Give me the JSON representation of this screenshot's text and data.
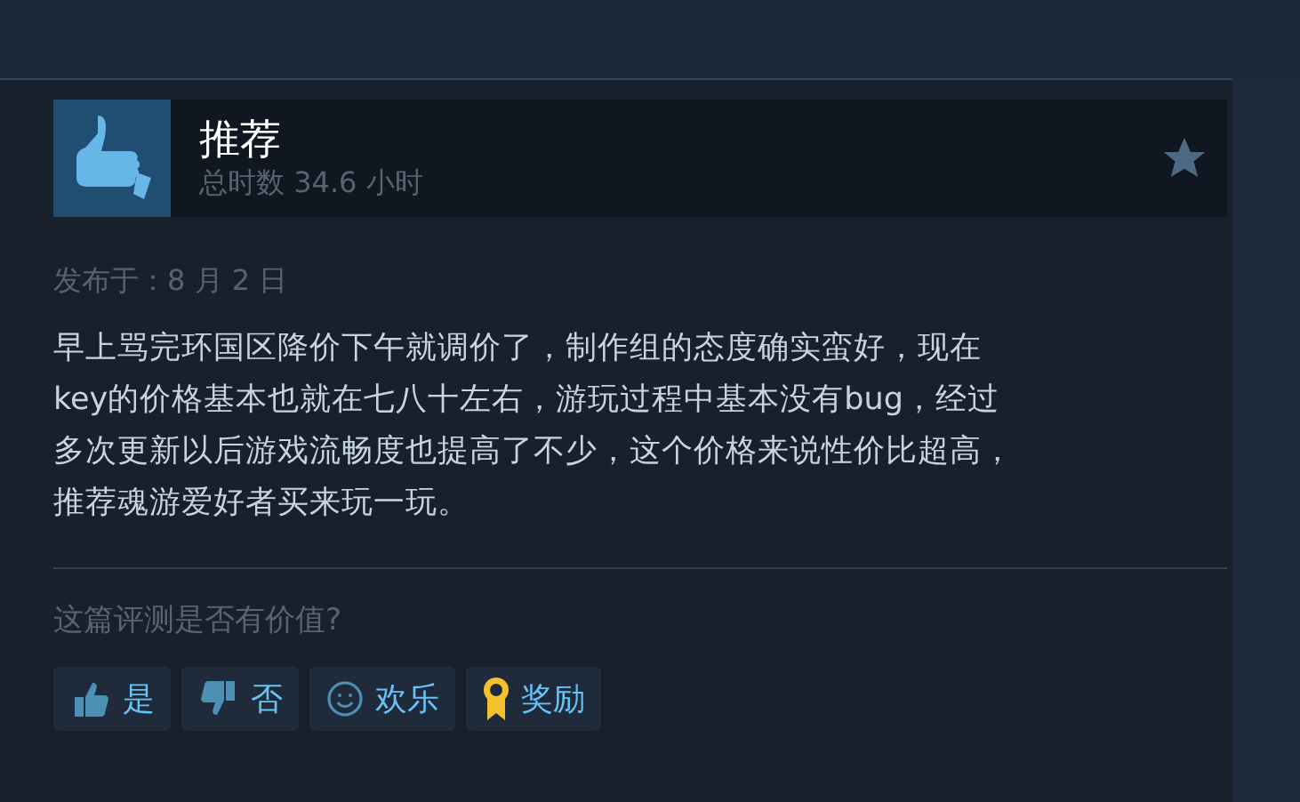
{
  "review": {
    "verdict": "推荐",
    "playtime": "总时数 34.6 小时",
    "posted": "发布于：8 月 2 日",
    "body_lines": [
      "早上骂完环国区降价下午就调价了，制作组的态度确实蛮好，现在",
      "key的价格基本也就在七八十左右，游玩过程中基本没有bug，经过",
      "多次更新以后游戏流畅度也提高了不少，这个价格来说性价比超高，",
      "推荐魂游爱好者买来玩一玩。"
    ]
  },
  "helpful": {
    "question": "这篇评测是否有价值?",
    "buttons": [
      {
        "kind": "up",
        "label": "是"
      },
      {
        "kind": "down",
        "label": "否"
      },
      {
        "kind": "funny",
        "label": "欢乐"
      },
      {
        "kind": "award",
        "label": "奖励"
      }
    ]
  }
}
